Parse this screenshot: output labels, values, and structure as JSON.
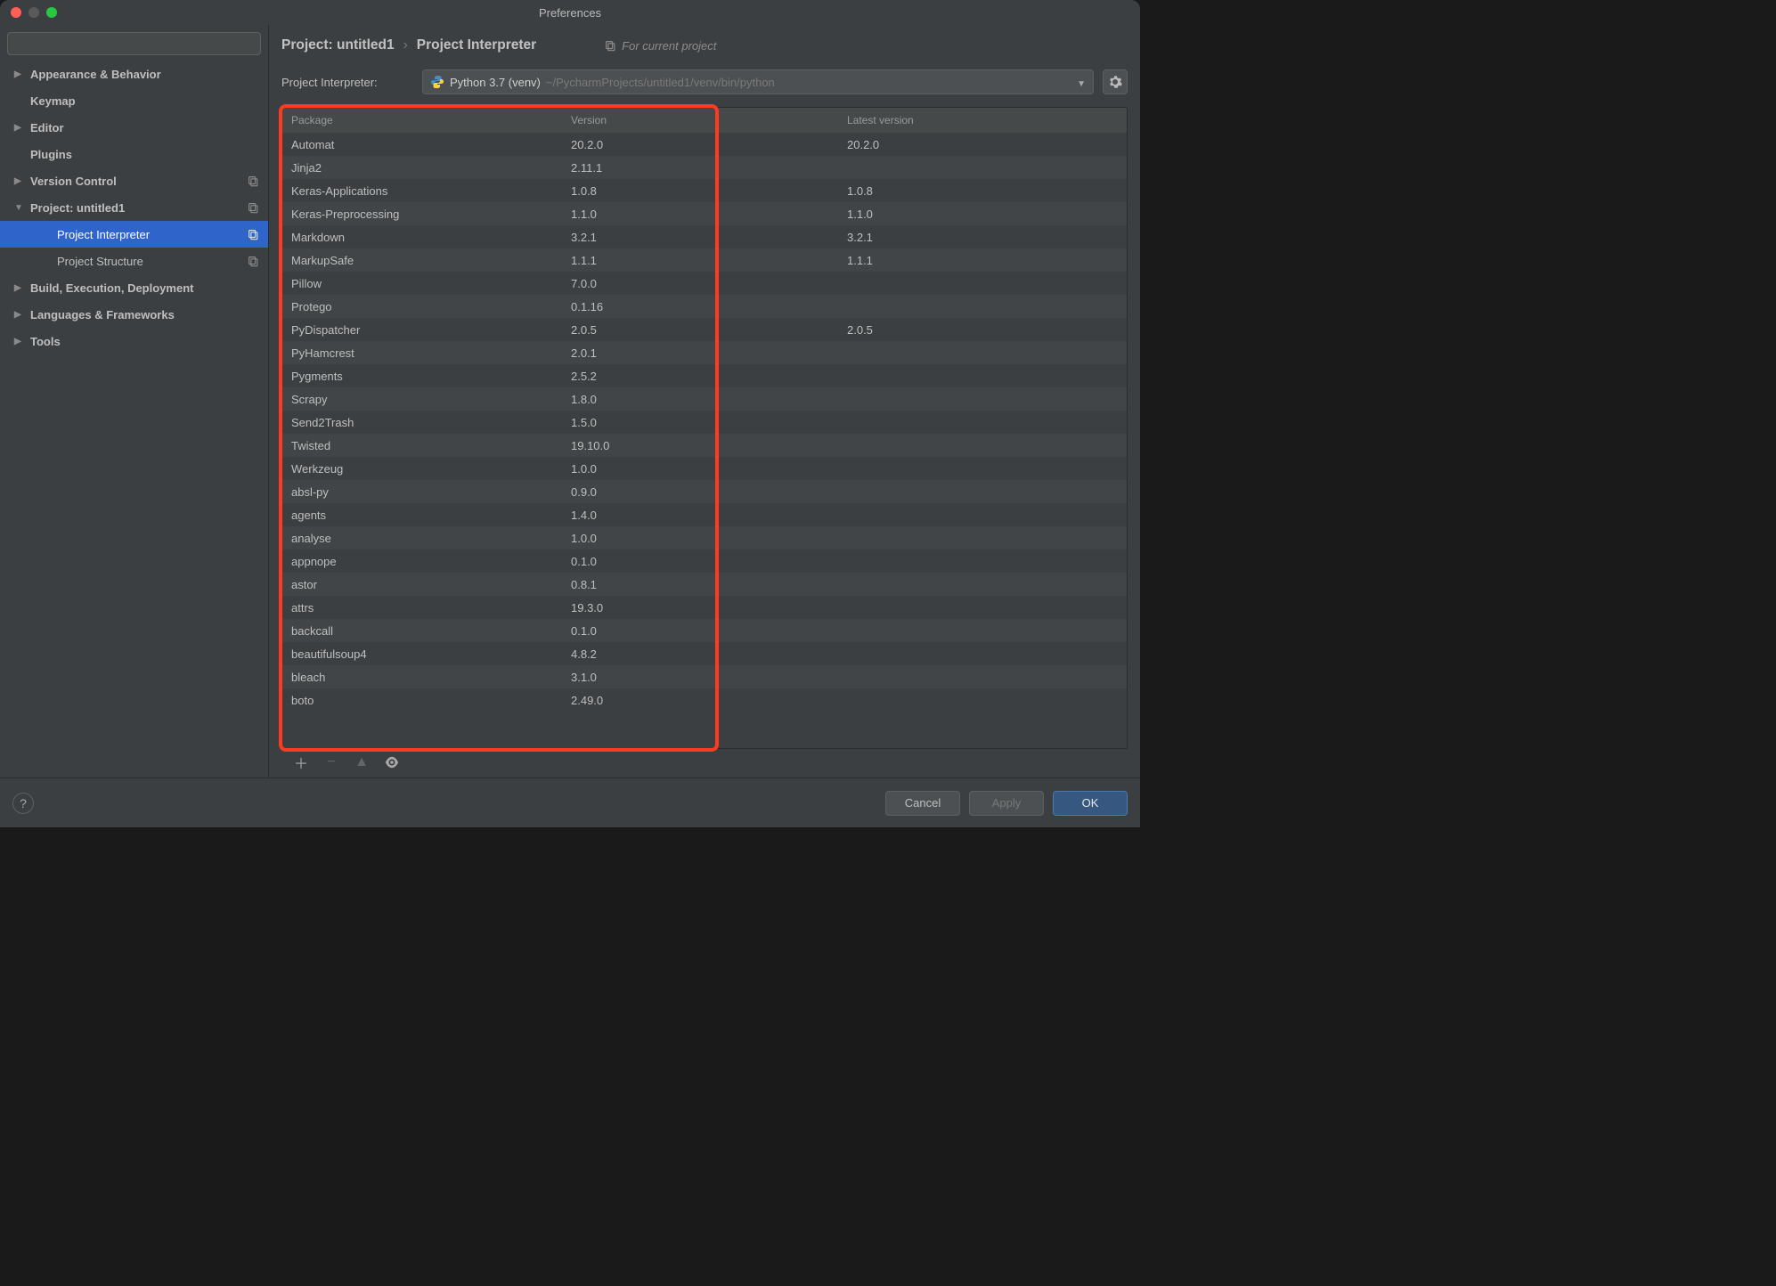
{
  "window": {
    "title": "Preferences"
  },
  "search": {
    "placeholder": ""
  },
  "sidebar": {
    "items": [
      {
        "label": "Appearance & Behavior",
        "expandable": true,
        "expanded": false
      },
      {
        "label": "Keymap",
        "expandable": false
      },
      {
        "label": "Editor",
        "expandable": true,
        "expanded": false
      },
      {
        "label": "Plugins",
        "expandable": false
      },
      {
        "label": "Version Control",
        "expandable": true,
        "expanded": false,
        "projIcon": true
      },
      {
        "label": "Project: untitled1",
        "expandable": true,
        "expanded": true,
        "projIcon": true
      },
      {
        "label": "Project Interpreter",
        "child": true,
        "selected": true,
        "projIcon": true
      },
      {
        "label": "Project Structure",
        "child": true,
        "projIcon": true
      },
      {
        "label": "Build, Execution, Deployment",
        "expandable": true,
        "expanded": false
      },
      {
        "label": "Languages & Frameworks",
        "expandable": true,
        "expanded": false
      },
      {
        "label": "Tools",
        "expandable": true,
        "expanded": false
      }
    ]
  },
  "breadcrumb": {
    "parent": "Project: untitled1",
    "child": "Project Interpreter",
    "for_current": "For current project"
  },
  "interpreter": {
    "label": "Project Interpreter:",
    "name": "Python 3.7 (venv)",
    "path": "~/PycharmProjects/untitled1/venv/bin/python"
  },
  "table": {
    "headers": {
      "package": "Package",
      "version": "Version",
      "latest": "Latest version"
    },
    "rows": [
      {
        "package": "Automat",
        "version": "20.2.0",
        "latest": "20.2.0"
      },
      {
        "package": "Jinja2",
        "version": "2.11.1",
        "latest": ""
      },
      {
        "package": "Keras-Applications",
        "version": "1.0.8",
        "latest": "1.0.8"
      },
      {
        "package": "Keras-Preprocessing",
        "version": "1.1.0",
        "latest": "1.1.0"
      },
      {
        "package": "Markdown",
        "version": "3.2.1",
        "latest": "3.2.1"
      },
      {
        "package": "MarkupSafe",
        "version": "1.1.1",
        "latest": "1.1.1"
      },
      {
        "package": "Pillow",
        "version": "7.0.0",
        "latest": ""
      },
      {
        "package": "Protego",
        "version": "0.1.16",
        "latest": ""
      },
      {
        "package": "PyDispatcher",
        "version": "2.0.5",
        "latest": "2.0.5"
      },
      {
        "package": "PyHamcrest",
        "version": "2.0.1",
        "latest": ""
      },
      {
        "package": "Pygments",
        "version": "2.5.2",
        "latest": ""
      },
      {
        "package": "Scrapy",
        "version": "1.8.0",
        "latest": ""
      },
      {
        "package": "Send2Trash",
        "version": "1.5.0",
        "latest": ""
      },
      {
        "package": "Twisted",
        "version": "19.10.0",
        "latest": ""
      },
      {
        "package": "Werkzeug",
        "version": "1.0.0",
        "latest": ""
      },
      {
        "package": "absl-py",
        "version": "0.9.0",
        "latest": ""
      },
      {
        "package": "agents",
        "version": "1.4.0",
        "latest": ""
      },
      {
        "package": "analyse",
        "version": "1.0.0",
        "latest": ""
      },
      {
        "package": "appnope",
        "version": "0.1.0",
        "latest": ""
      },
      {
        "package": "astor",
        "version": "0.8.1",
        "latest": ""
      },
      {
        "package": "attrs",
        "version": "19.3.0",
        "latest": ""
      },
      {
        "package": "backcall",
        "version": "0.1.0",
        "latest": ""
      },
      {
        "package": "beautifulsoup4",
        "version": "4.8.2",
        "latest": ""
      },
      {
        "package": "bleach",
        "version": "3.1.0",
        "latest": ""
      },
      {
        "package": "boto",
        "version": "2.49.0",
        "latest": ""
      }
    ]
  },
  "footer": {
    "cancel": "Cancel",
    "apply": "Apply",
    "ok": "OK"
  }
}
